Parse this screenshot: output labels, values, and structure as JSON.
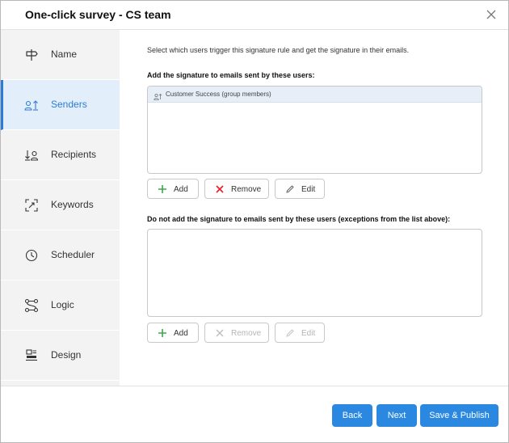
{
  "dialog": {
    "title": "One-click survey - CS team"
  },
  "sidebar": {
    "items": [
      {
        "label": "Name",
        "icon": "signpost-icon"
      },
      {
        "label": "Senders",
        "icon": "users-arrow-icon"
      },
      {
        "label": "Recipients",
        "icon": "users-arrow-icon"
      },
      {
        "label": "Keywords",
        "icon": "keyword-scan-icon"
      },
      {
        "label": "Scheduler",
        "icon": "clock-icon"
      },
      {
        "label": "Logic",
        "icon": "logic-flow-icon"
      },
      {
        "label": "Design",
        "icon": "layout-design-icon"
      }
    ],
    "active_index": 1
  },
  "main": {
    "intro": "Select which users trigger this signature rule and get the signature in their emails.",
    "include_section": {
      "title": "Add the signature to emails sent by these users:",
      "items": [
        "Customer Success (group members)"
      ],
      "buttons": {
        "add": "Add",
        "remove": "Remove",
        "edit": "Edit"
      }
    },
    "exclude_section": {
      "title": "Do not add the signature to emails sent by these users (exceptions from the list above):",
      "items": [],
      "buttons": {
        "add": "Add",
        "remove": "Remove",
        "edit": "Edit"
      }
    }
  },
  "footer": {
    "back": "Back",
    "next": "Next",
    "save_publish": "Save & Publish"
  },
  "colors": {
    "accent": "#2b88e0",
    "active_nav": "#2b7bd8",
    "add_green": "#3aa84a",
    "remove_red": "#e0262b"
  }
}
